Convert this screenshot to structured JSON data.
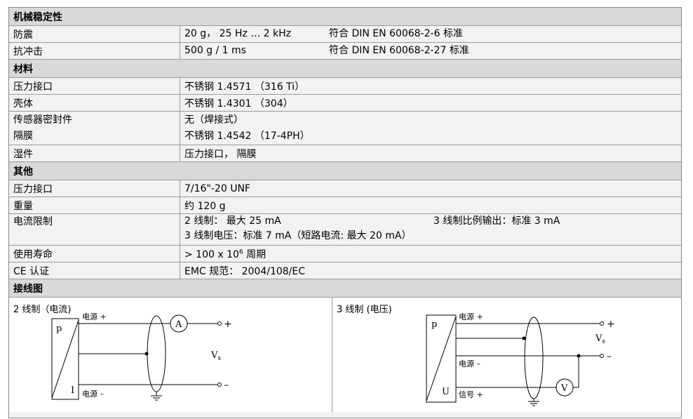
{
  "mechanical": {
    "title": "机械稳定性",
    "vibration": {
      "label": "防震",
      "value": "20 g，  25 Hz … 2 kHz",
      "std": "符合 DIN EN 60068-2-6 标准"
    },
    "shock": {
      "label": "抗冲击",
      "value": "500 g / 1 ms",
      "std": "符合 DIN EN 60068-2-27 标准"
    }
  },
  "materials": {
    "title": "材料",
    "port": {
      "label": "压力接口",
      "value": "不锈钢 1.4571 （316 Ti）"
    },
    "housing": {
      "label": "壳体",
      "value": "不锈钢 1.4301 （304）"
    },
    "seal": {
      "label": "传感器密封件",
      "value": "无（焊接式）"
    },
    "diaphragm": {
      "label": "隔膜",
      "value": "不锈钢 1.4542 （17-4PH）"
    },
    "wetted": {
      "label": "湿件",
      "value": "压力接口，  隔膜"
    }
  },
  "other": {
    "title": "其他",
    "port": {
      "label": "压力接口",
      "value": "7/16\"-20 UNF"
    },
    "weight": {
      "label": "重量",
      "value": "约 120 g"
    },
    "current_limit": {
      "label": "电流限制",
      "line1_a": "2 线制：  最大 25 mA",
      "line1_b": "3 线制比例输出：标准 3 mA",
      "line2": "3 线制电压：标准 7 mA（短路电流: 最大 20 mA）"
    },
    "life": {
      "label": "使用寿命",
      "value_pre": "> 100 x 10",
      "value_sup": "6",
      "value_post": " 周期"
    },
    "ce": {
      "label": "CE 认证",
      "value": "EMC 规范：  2004/108/EC"
    }
  },
  "wiring": {
    "title": "接线图",
    "two_wire": {
      "title": "2 线制（电流)",
      "p": "p",
      "i": "I",
      "supply_plus": "电源 +",
      "supply_minus": "电源 –",
      "meter": "A",
      "vs": "V",
      "vs_sub": "s",
      "plus": "+",
      "minus": "–"
    },
    "three_wire": {
      "title": "3 线制 (电压)",
      "p": "p",
      "u": "U",
      "supply_plus": "电源 +",
      "supply_minus": "电源 –",
      "signal_plus": "信号 +",
      "meter": "V",
      "vs": "V",
      "vs_sub": "s",
      "plus": "+",
      "minus": "–"
    }
  }
}
